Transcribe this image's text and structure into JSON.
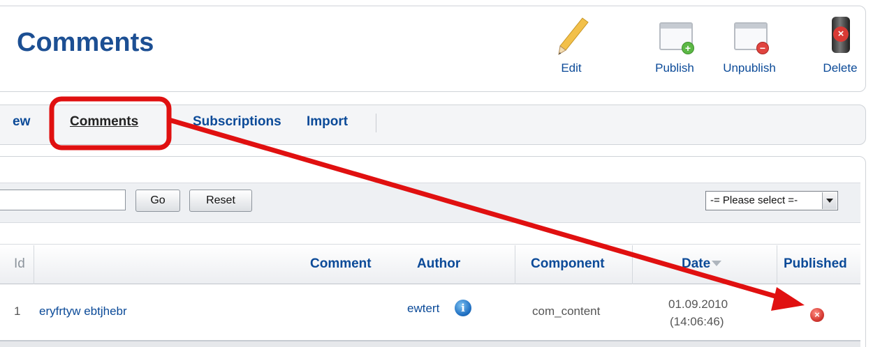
{
  "header": {
    "title": "Comments"
  },
  "toolbar": {
    "edit_label": "Edit",
    "publish_label": "Publish",
    "unpublish_label": "Unpublish",
    "delete_label": "Delete"
  },
  "subnav": {
    "tabs": [
      "ew",
      "Comments",
      "Subscriptions",
      "Import"
    ],
    "active": "Comments"
  },
  "filter": {
    "search_value": "",
    "go_label": "Go",
    "reset_label": "Reset",
    "select_value": "-= Please select =-"
  },
  "table": {
    "columns": [
      "Id",
      "Comment",
      "Author",
      "Component",
      "Date",
      "Published"
    ],
    "rows": [
      {
        "id": "1",
        "title": "eryfrtyw ebtjhebr",
        "author": "ewtert",
        "component": "com_content",
        "date": "01.09.2010",
        "time": "(14:06:46)",
        "published": false
      }
    ]
  },
  "colors": {
    "link": "#0b4a98",
    "annotation": "#e01010"
  },
  "icons": [
    "pencil-icon",
    "publish-icon",
    "unpublish-icon",
    "trash-icon",
    "info-icon",
    "unpublished-icon",
    "sort-desc-icon",
    "dropdown-arrow-icon"
  ]
}
